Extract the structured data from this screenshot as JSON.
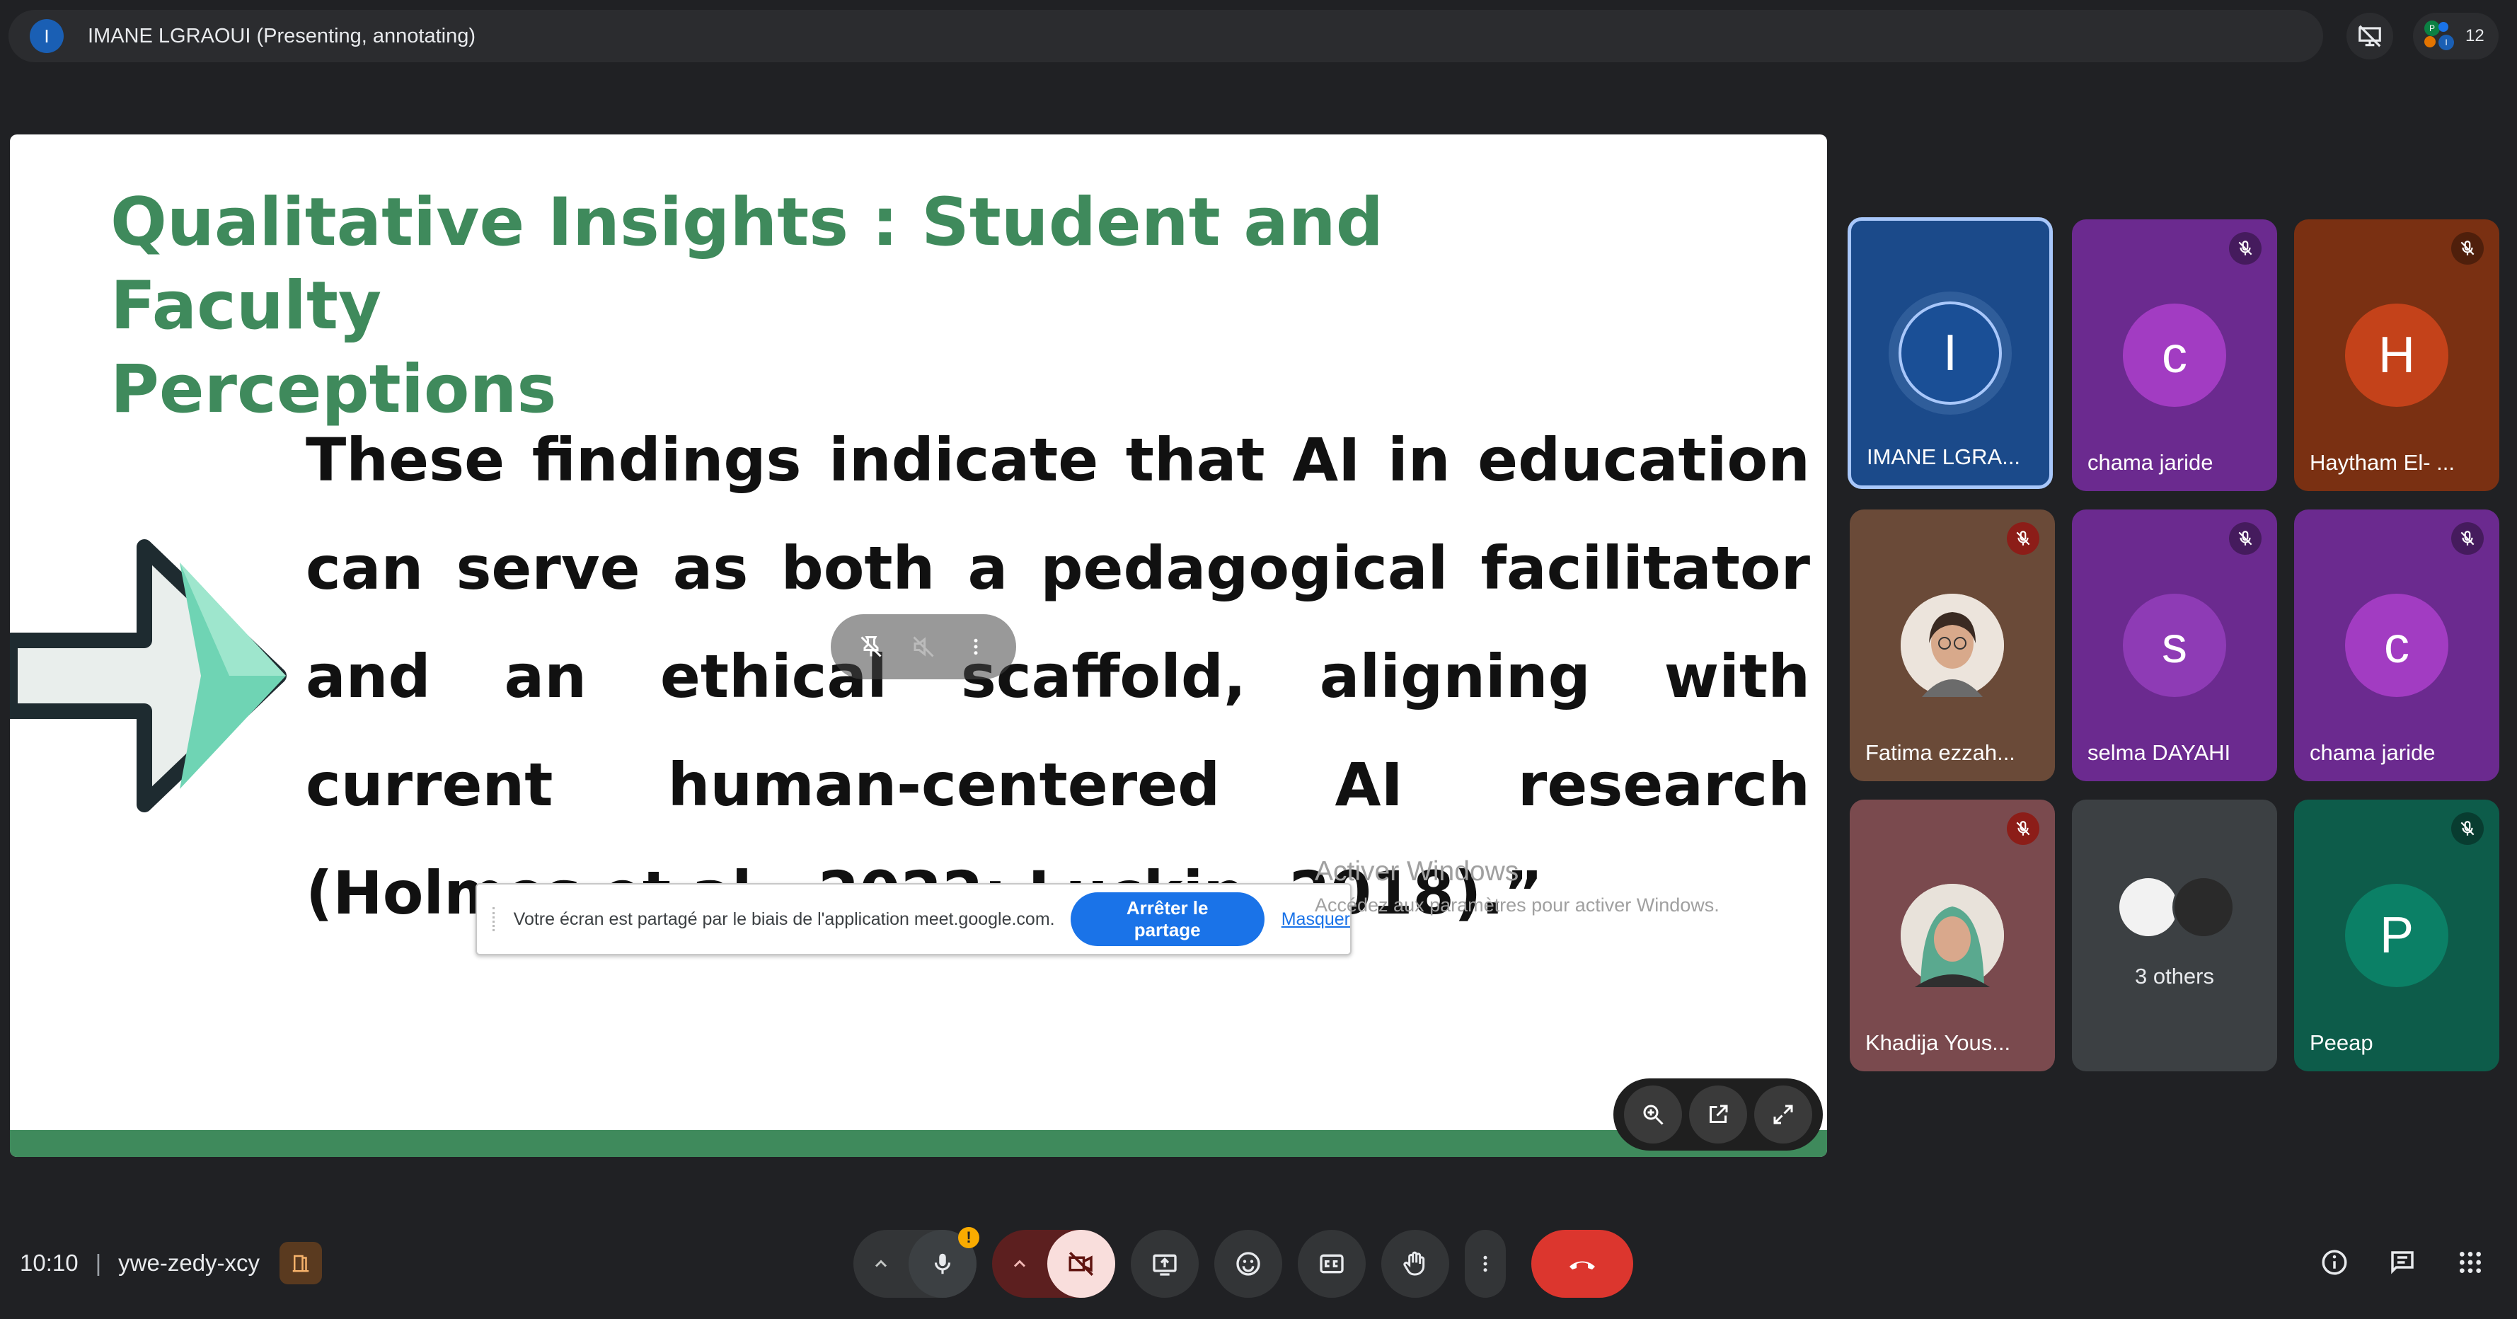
{
  "presenter_bar": {
    "avatar_letter": "I",
    "name": "IMANE LGRAOUI (Presenting, annotating)",
    "participant_count": "12"
  },
  "slide": {
    "title_line1": "Qualitative Insights : Student and Faculty",
    "title_line2": "Perceptions",
    "body": "These findings indicate that AI in education can serve as both a pedagogical facilitator and an ethical scaffold, aligning with current human-centered AI research (Holmes et al., 2022; Luckin, 2018).”",
    "title_color": "#3f8a5c"
  },
  "share_notice": {
    "text": "Votre écran est partagé par le biais de l'application meet.google.com.",
    "stop_button": "Arrêter le partage",
    "hide_link": "Masquer"
  },
  "watermark": {
    "title": "Activer Windows",
    "subtitle": "Accédez aux paramètres pour activer Windows."
  },
  "participants": [
    {
      "letter": "I",
      "name": "IMANE LGRA...",
      "muted": false
    },
    {
      "letter": "c",
      "name": "chama jaride",
      "muted": true
    },
    {
      "letter": "H",
      "name": "Haytham El- ...",
      "muted": true
    },
    {
      "letter": "",
      "name": "Fatima ezzah...",
      "muted": true
    },
    {
      "letter": "s",
      "name": "selma DAYAHI",
      "muted": true
    },
    {
      "letter": "c",
      "name": "chama jaride",
      "muted": true
    },
    {
      "letter": "",
      "name": "Khadija Yous...",
      "muted": true
    },
    {
      "letter": "",
      "name": "3 others",
      "muted": false
    },
    {
      "letter": "P",
      "name": "Peeap",
      "muted": true
    }
  ],
  "meeting": {
    "time": "10:10",
    "separator": "|",
    "code": "ywe-zedy-xcy"
  },
  "mic_warning": "!",
  "colors": {
    "background": "#202124",
    "hangup": "#dc362e",
    "accent_blue": "#1a73e8",
    "active_tile_border": "#a8c7fa"
  }
}
